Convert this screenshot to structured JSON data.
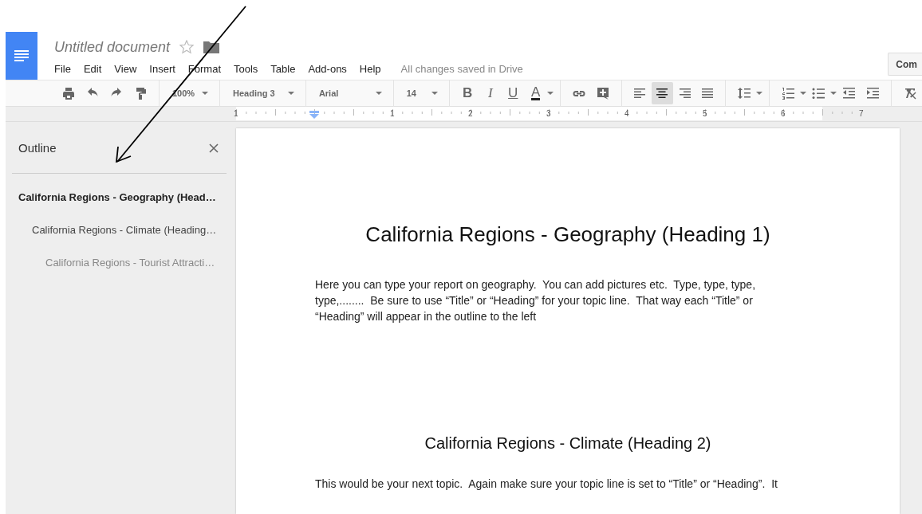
{
  "document": {
    "title": "Untitled document",
    "starred": false
  },
  "menu": [
    "File",
    "Edit",
    "View",
    "Insert",
    "Format",
    "Tools",
    "Table",
    "Add-ons",
    "Help"
  ],
  "save_status": "All changes saved in Drive",
  "comment_button": "Com",
  "toolbar": {
    "zoom": "100%",
    "style": "Heading 3",
    "font": "Arial",
    "size": "14",
    "format_buttons": [
      "B",
      "I",
      "U",
      "A"
    ],
    "alignments": [
      {
        "kind": "left",
        "selected": false
      },
      {
        "kind": "center",
        "selected": true
      },
      {
        "kind": "right",
        "selected": false
      },
      {
        "kind": "justify",
        "selected": false
      }
    ]
  },
  "ruler": {
    "numbers": [
      "1",
      "1",
      "2",
      "3",
      "4",
      "5",
      "6",
      "7"
    ]
  },
  "outline": {
    "title": "Outline",
    "items": [
      {
        "text": "California Regions - Geography (Head…",
        "selected": true,
        "children": [
          {
            "text": "California Regions - Climate (Heading…",
            "selected": false,
            "children": [
              {
                "text": "California Regions - Tourist Attracti…",
                "selected": false
              }
            ]
          }
        ]
      }
    ]
  },
  "page": {
    "blocks": [
      {
        "kind": "heading1",
        "text": "California Regions - Geography (Heading 1)"
      },
      {
        "kind": "paragraph",
        "text": "Here you can type your report on geography.  You can add pictures etc.  Type, type, type, type,........  Be sure to use “Title” or “Heading” for your topic line.  That way each “Title” or “Heading” will appear in the outline to the left"
      },
      {
        "kind": "heading2",
        "text": "California Regions - Climate (Heading 2)"
      },
      {
        "kind": "paragraph",
        "text": "This would be your next topic.  Again make sure your topic line is set to “Title” or “Heading”.  It"
      }
    ]
  }
}
